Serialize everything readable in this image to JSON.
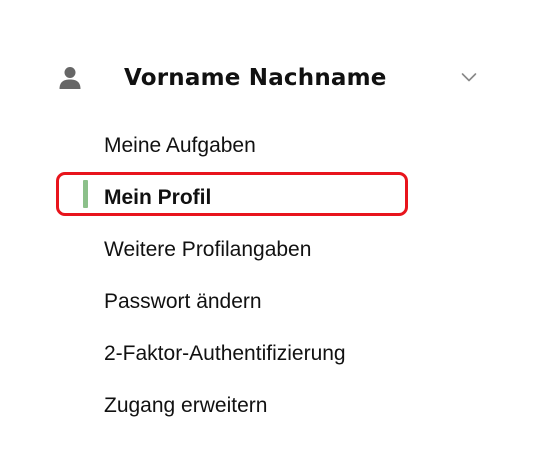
{
  "account": {
    "icon": "user-icon",
    "name": "Vorname Nachname",
    "toggle_icon": "chevron-down-icon"
  },
  "menu": {
    "items": [
      {
        "label": "Meine Aufgaben",
        "active": false
      },
      {
        "label": "Mein Profil",
        "active": true
      },
      {
        "label": "Weitere Profilangaben",
        "active": false
      },
      {
        "label": "Passwort ändern",
        "active": false
      },
      {
        "label": "2-Faktor-Authentifizierung",
        "active": false
      },
      {
        "label": "Zugang erweitern",
        "active": false
      }
    ]
  },
  "colors": {
    "active_indicator": "#8cc08a",
    "highlight_frame": "#e8141c",
    "text": "#111111",
    "icon": "#666666"
  }
}
